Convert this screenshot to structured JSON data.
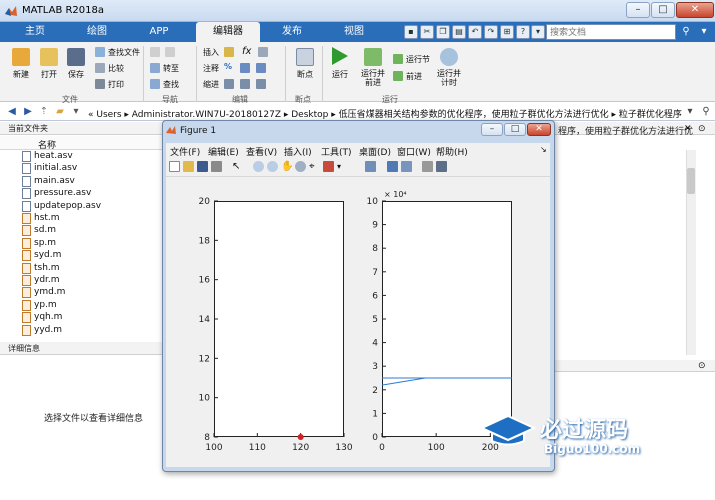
{
  "window": {
    "title": "MATLAB R2018a"
  },
  "tabs": [
    "主页",
    "绘图",
    "APP",
    "编辑器",
    "发布",
    "视图"
  ],
  "active_tab": 3,
  "search": {
    "placeholder": "搜索文档"
  },
  "ribbon": {
    "groups": [
      {
        "label": "文件",
        "big": [
          "新建",
          "打开",
          "保存"
        ],
        "small": [
          "查找文件",
          "比较",
          "打印"
        ]
      },
      {
        "label": "导航",
        "small": [
          "转至",
          "查找"
        ]
      },
      {
        "label": "编辑",
        "small": [
          "插入",
          "注释",
          "缩进"
        ]
      },
      {
        "label": "断点",
        "big": [
          "断点"
        ]
      },
      {
        "label": "运行",
        "big": [
          "运行",
          "运行并\n前进",
          "运行并\n计时"
        ],
        "small": [
          "运行节",
          "前进"
        ]
      }
    ]
  },
  "address": {
    "text": "«  Users  ▸  Administrator.WIN7U-20180127Z  ▸  Desktop  ▸  低压省煤器相关结构参数的优化程序，使用粒子群优化方法进行优化  ▸  粒子群优化程序"
  },
  "current_folder": {
    "title": "当前文件夹",
    "column": "名称",
    "files": [
      {
        "name": "heat.asv",
        "type": "asv"
      },
      {
        "name": "initial.asv",
        "type": "asv"
      },
      {
        "name": "main.asv",
        "type": "asv"
      },
      {
        "name": "pressure.asv",
        "type": "asv"
      },
      {
        "name": "updatepop.asv",
        "type": "asv"
      },
      {
        "name": "hst.m",
        "type": "m"
      },
      {
        "name": "sd.m",
        "type": "m"
      },
      {
        "name": "sp.m",
        "type": "m"
      },
      {
        "name": "syd.m",
        "type": "m"
      },
      {
        "name": "tsh.m",
        "type": "m"
      },
      {
        "name": "ydr.m",
        "type": "m"
      },
      {
        "name": "ymd.m",
        "type": "m"
      },
      {
        "name": "yp.m",
        "type": "m"
      },
      {
        "name": "yqh.m",
        "type": "m"
      },
      {
        "name": "yyd.m",
        "type": "m"
      }
    ]
  },
  "details": {
    "title": "详细信息",
    "message": "选择文件以查看详细信息"
  },
  "right_panel": {
    "text": "程序，使用粒子群优化方法进行优"
  },
  "figure": {
    "title": "Figure 1",
    "menus": [
      "文件(F)",
      "编辑(E)",
      "查看(V)",
      "插入(I)",
      "工具(T)",
      "桌面(D)",
      "窗口(W)",
      "帮助(H)"
    ]
  },
  "chart_data": [
    {
      "type": "scatter",
      "x": [
        120
      ],
      "y": [
        8
      ],
      "xlim": [
        100,
        130
      ],
      "ylim": [
        8,
        20
      ],
      "xticks": [
        100,
        110,
        120,
        130
      ],
      "yticks": [
        8,
        10,
        12,
        14,
        16,
        18,
        20
      ],
      "marker_color": "#d42020"
    },
    {
      "type": "line",
      "x": [
        0,
        80,
        240
      ],
      "y": [
        22000,
        25000,
        25000
      ],
      "x2": [
        0,
        240
      ],
      "y2": [
        25000,
        25000
      ],
      "xlim": [
        0,
        240
      ],
      "ylim": [
        0,
        100000
      ],
      "xticks": [
        0,
        100,
        200
      ],
      "yticks": [
        0,
        1,
        2,
        3,
        4,
        5,
        6,
        7,
        8,
        9,
        10
      ],
      "exponent_label": "× 10⁴",
      "line_color": "#2b7bd0"
    }
  ],
  "watermark": {
    "text": "必过源码",
    "url": "Biguo100.com"
  },
  "colors": {
    "accent": "#2a6db8",
    "ribbon": "#f2f2f2"
  }
}
